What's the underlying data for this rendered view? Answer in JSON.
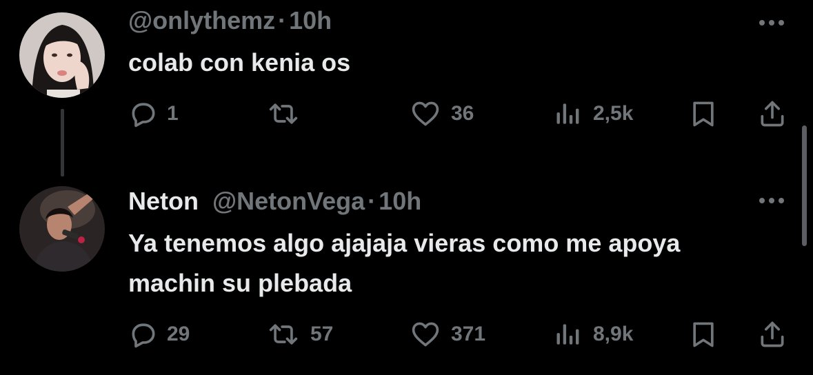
{
  "tweets": [
    {
      "author_name": "",
      "handle": "@onlythemz",
      "separator": "·",
      "time": "10h",
      "text": "colab con kenia os",
      "replies": "1",
      "reposts": "",
      "likes": "36",
      "views": "2,5k"
    },
    {
      "author_name": "Neton",
      "handle": "@NetonVega",
      "separator": "·",
      "time": "10h",
      "text": "Ya tenemos algo ajajaja vieras como me apoya machin su plebada",
      "replies": "29",
      "reposts": "57",
      "likes": "371",
      "views": "8,9k"
    }
  ],
  "icons": {
    "reply": "reply-icon",
    "repost": "repost-icon",
    "like": "heart-icon",
    "views": "views-icon",
    "bookmark": "bookmark-icon",
    "share": "share-icon",
    "more": "more-icon"
  },
  "colors": {
    "background": "#000000",
    "text_primary": "#e7e9ea",
    "text_secondary": "#71767b",
    "thread_line": "#333639"
  }
}
